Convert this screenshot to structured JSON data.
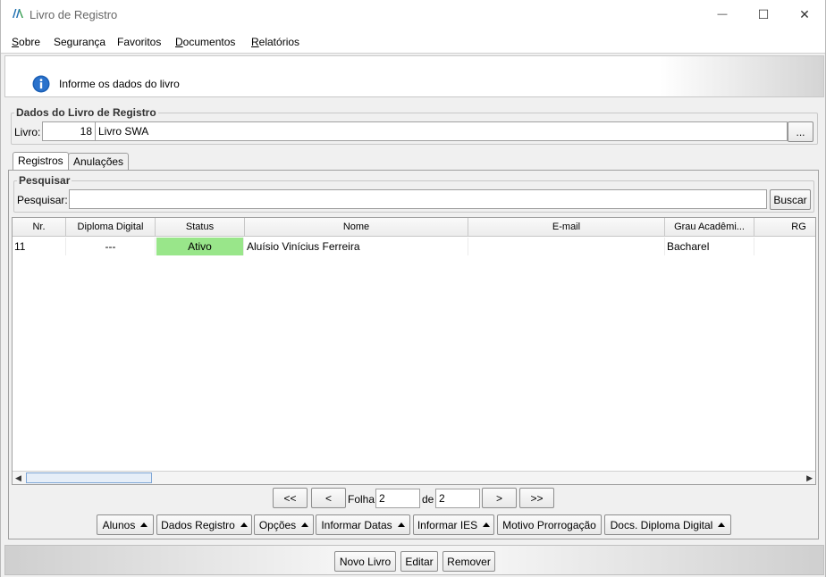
{
  "window": {
    "title": "Livro de Registro",
    "logo_icon": "app-logo-icon",
    "minimize_symbol": "—",
    "maximize_symbol": "☐",
    "close_symbol": "✕"
  },
  "menu": [
    {
      "underline": "S",
      "rest": "obre"
    },
    {
      "underline": "",
      "rest": "Segurança"
    },
    {
      "underline": "",
      "rest": "Favoritos"
    },
    {
      "underline": "D",
      "rest": "ocumentos"
    },
    {
      "underline": "R",
      "rest": "elatórios"
    }
  ],
  "banner": {
    "text": "Informe os dados do livro",
    "icon": "info-icon"
  },
  "livro_group": {
    "legend": "Dados do Livro de Registro",
    "label": "Livro:",
    "number": "18",
    "name": "Livro SWA",
    "browse_label": "..."
  },
  "tabs": [
    {
      "label": "Registros",
      "active": true
    },
    {
      "label": "Anulações",
      "active": false
    }
  ],
  "search": {
    "legend": "Pesquisar",
    "label": "Pesquisar:",
    "value": "",
    "button": "Buscar"
  },
  "table": {
    "columns": [
      "Nr.",
      "Diploma Digital",
      "Status",
      "Nome",
      "E-mail",
      "Grau Acadêmi...",
      "RG"
    ],
    "rows": [
      {
        "nr": "11",
        "diploma": "---",
        "status": "Ativo",
        "nome": "Aluísio Vinícius Ferreira",
        "email": "",
        "grau": "Bacharel",
        "rg": ""
      }
    ],
    "status_color": "#99e68a"
  },
  "pager": {
    "first": "<<",
    "prev": "<",
    "label_folha": "Folha",
    "folha": "2",
    "label_de": "de",
    "total": "2",
    "next": ">",
    "last": ">>"
  },
  "action_buttons": [
    "Alunos",
    "Dados Registro",
    "Opções",
    "Informar Datas",
    "Informar IES",
    "Motivo Prorrogação",
    "Docs. Diploma Digital"
  ],
  "footer_buttons": {
    "new": "Novo Livro",
    "edit": "Editar",
    "remove": "Remover"
  }
}
